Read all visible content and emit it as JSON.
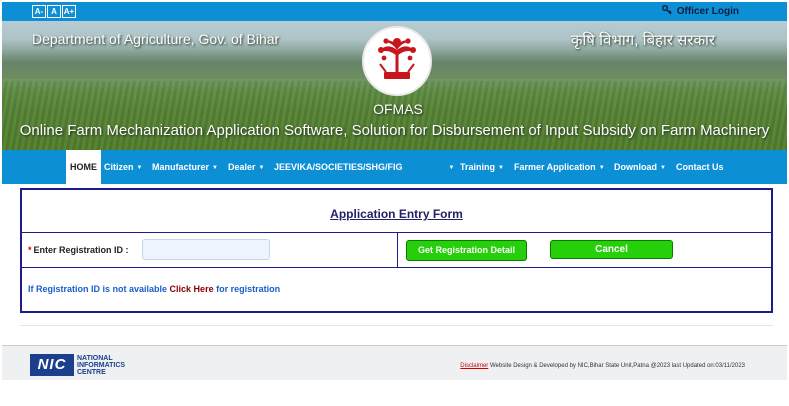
{
  "top_bar": {
    "font_buttons": [
      "A-",
      "A",
      "A+"
    ],
    "officer_login_icon": "key-icon",
    "officer_login": "Officer Login"
  },
  "header": {
    "dept_english": "Department of Agriculture, Gov. of Bihar",
    "dept_hindi": "कृषि विभाग, बिहार सरकार",
    "logo": "bihar-emblem",
    "app_short": "OFMAS",
    "app_full": "Online Farm Mechanization Application Software, Solution for Disbursement of Input Subsidy on Farm Machinery"
  },
  "nav": {
    "items": [
      {
        "label": "HOME",
        "dropdown": false
      },
      {
        "label": "Citizen",
        "dropdown": true
      },
      {
        "label": "Manufacturer",
        "dropdown": true
      },
      {
        "label": "Dealer",
        "dropdown": true
      },
      {
        "label": "JEEVIKA/SOCIETIES/SHG/FIG",
        "dropdown": true
      },
      {
        "label": "Training",
        "dropdown": true
      },
      {
        "label": "Farmer Application",
        "dropdown": true
      },
      {
        "label": "Download",
        "dropdown": true
      },
      {
        "label": "Contact Us",
        "dropdown": false
      }
    ],
    "caret": "▼"
  },
  "form": {
    "title": "Application Entry Form",
    "required_mark": "*",
    "reg_label": "Enter Registration ID :",
    "reg_value": "",
    "get_detail_button": "Get Registration Detail",
    "cancel_button": "Cancel",
    "note_prefix": "If Registration ID is not available",
    "note_link": "Click Here",
    "note_suffix": "for registration"
  },
  "footer": {
    "nic_mark": "NIC",
    "nic_line1": "NATIONAL",
    "nic_line2": "INFORMATICS",
    "nic_line3": "CENTRE",
    "disclaimer": "Disclaimer",
    "credit": "Website Design & Developed by NIC,Bihar State Unit,Patna @2023 last Updated on:03/11/2023"
  },
  "colors": {
    "primary_blue": "#0d8fd6",
    "button_green": "#25d00a",
    "form_border": "#1c1c8a"
  }
}
